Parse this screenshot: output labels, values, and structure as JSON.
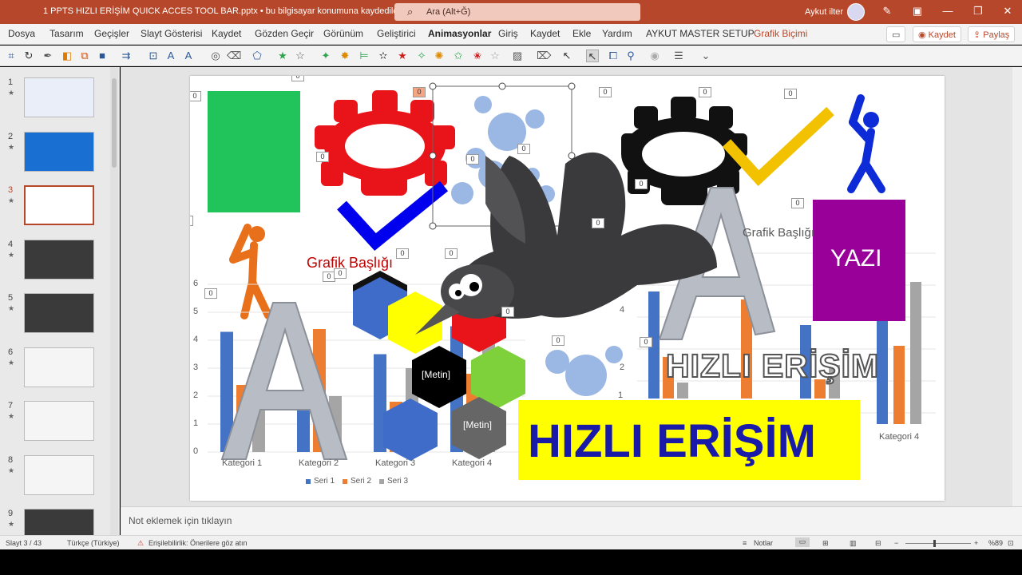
{
  "window": {
    "title": "1 PPTS HIZLI ERİŞİM QUICK ACCES TOOL BAR.pptx • bu bilgisayar konumuna kaydedildi",
    "search_placeholder": "Ara (Alt+Ğ)",
    "user_name": "Aykut ilter"
  },
  "menu": {
    "items": [
      "Dosya",
      "Tasarım",
      "Geçişler",
      "Slayt Gösterisi",
      "Kaydet",
      "Gözden Geçir",
      "Görünüm",
      "Geliştirici",
      "Animasyonlar",
      "Giriş",
      "Kaydet",
      "Ekle",
      "Yardım",
      "AYKUT MASTER SETUP",
      "Grafik Biçimi"
    ],
    "active": "Animasyonlar",
    "accent": "Grafik Biçimi",
    "save_button": "Kaydet",
    "share_button": "Paylaş"
  },
  "thumbnails": [
    {
      "num": "1",
      "star": "★"
    },
    {
      "num": "2",
      "star": "★"
    },
    {
      "num": "3",
      "star": "★"
    },
    {
      "num": "4",
      "star": "★"
    },
    {
      "num": "5",
      "star": "★"
    },
    {
      "num": "6",
      "star": "★"
    },
    {
      "num": "7",
      "star": "★"
    },
    {
      "num": "8",
      "star": "★"
    },
    {
      "num": "9",
      "star": "★"
    }
  ],
  "selected_slide": "3",
  "slide": {
    "chart_title_left": "Grafik Başlığı",
    "chart_title_right": "Grafik Başlığı",
    "hex_label_1": "[Metin]",
    "hex_label_2": "[Metin]",
    "yazi_box": "YAZI",
    "wordart_outline": "HIZLI ERİŞİM",
    "wordart_main": "HIZLI ERİŞİM",
    "zero_tag": "0",
    "colors": {
      "green_rect": "#21c45a",
      "purple_rect": "#990099",
      "yellow_banner": "#ffff00",
      "wordart_blue": "#1a1aa8",
      "check_blue": "#0000ee",
      "check_yellow": "#f2c200"
    }
  },
  "chart_data": [
    {
      "type": "bar",
      "title": "Grafik Başlığı",
      "categories": [
        "Kategori 1",
        "Kategori 2",
        "Kategori 3",
        "Kategori 4"
      ],
      "series": [
        {
          "name": "Seri 1",
          "values": [
            4.3,
            2.5,
            3.5,
            4.5
          ],
          "color": "#4472c4"
        },
        {
          "name": "Seri 2",
          "values": [
            2.4,
            4.4,
            1.8,
            2.8
          ],
          "color": "#ed7d31"
        },
        {
          "name": "Seri 3",
          "values": [
            2.0,
            2.0,
            3.0,
            5.0
          ],
          "color": "#a5a5a5"
        }
      ],
      "ylim": [
        0,
        6
      ],
      "yticks": [
        "0",
        "1",
        "2",
        "3",
        "4",
        "5",
        "6"
      ],
      "legend": "bottom"
    },
    {
      "type": "bar",
      "title": "Grafik Başlığı",
      "categories": [
        "Kategori 4"
      ],
      "yticks": [
        "1",
        "2",
        "4"
      ],
      "partial": true
    }
  ],
  "notes": {
    "placeholder": "Not eklemek için tıklayın"
  },
  "status": {
    "slide_counter": "Slayt 3 / 43",
    "language": "Türkçe (Türkiye)",
    "accessibility": "Erişilebilirlik: Önerilere göz atın",
    "notes_button": "Notlar",
    "zoom": "%89"
  }
}
